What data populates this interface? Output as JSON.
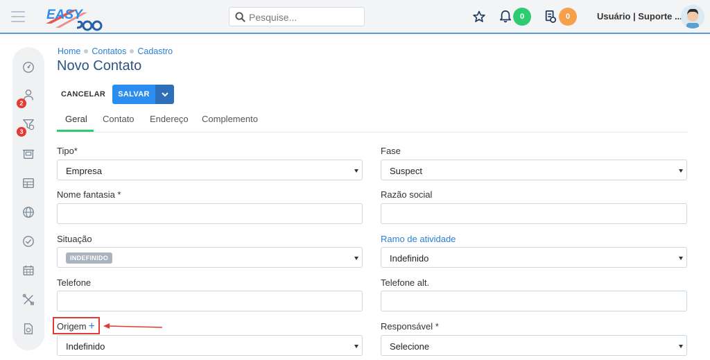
{
  "header": {
    "search_placeholder": "Pesquise...",
    "notifications_count": "0",
    "tasks_count": "0",
    "user_name": "Usuário | Suporte ..."
  },
  "sidebar": {
    "badge_1": "2",
    "badge_2": "3"
  },
  "breadcrumb": [
    "Home",
    "Contatos",
    "Cadastro"
  ],
  "page": {
    "title": "Novo Contato",
    "cancel_label": "CANCELAR",
    "save_label": "SALVAR"
  },
  "tabs": [
    {
      "label": "Geral",
      "active": true
    },
    {
      "label": "Contato"
    },
    {
      "label": "Endereço"
    },
    {
      "label": "Complemento"
    }
  ],
  "form": {
    "tipo": {
      "label": "Tipo*",
      "value": "Empresa"
    },
    "fase": {
      "label": "Fase",
      "value": "Suspect"
    },
    "nome_fantasia": {
      "label": "Nome fantasia *",
      "value": ""
    },
    "razao_social": {
      "label": "Razão social",
      "value": ""
    },
    "situacao": {
      "label": "Situação",
      "value": "INDEFINIDO"
    },
    "ramo": {
      "label": "Ramo de atividade",
      "value": "Indefinido"
    },
    "telefone": {
      "label": "Telefone",
      "value": ""
    },
    "telefone_alt": {
      "label": "Telefone alt.",
      "value": ""
    },
    "origem": {
      "label": "Origem",
      "plus": "+",
      "value": "Indefinido"
    },
    "responsavel": {
      "label": "Responsável *",
      "value": "Selecione"
    }
  },
  "colors": {
    "accent": "#2a8ef0",
    "tab_active": "#2ecc71",
    "annotation": "#e53935"
  }
}
